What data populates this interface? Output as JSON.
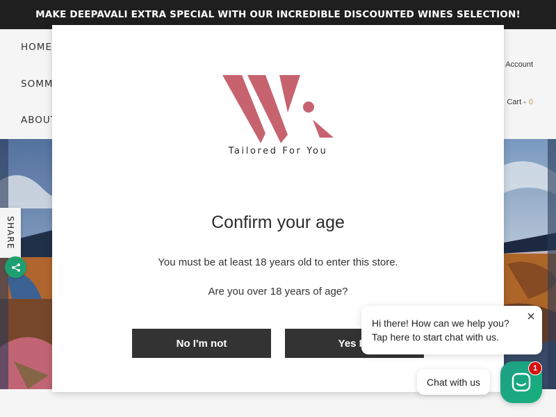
{
  "announcement": {
    "text": "MAKE DEEPAVALI EXTRA SPECIAL WITH OUR INCREDIBLE DISCOUNTED WINES SELECTION!"
  },
  "nav": {
    "items": [
      {
        "label": "HOME"
      },
      {
        "label": "SOMME"
      },
      {
        "label": "ABOUT"
      }
    ]
  },
  "header": {
    "account_label": "Account",
    "cart_label": "Cart -",
    "cart_count": "0",
    "icons": {
      "cart": "cart-icon"
    }
  },
  "share": {
    "label": "SHARE",
    "icon": "share-icon",
    "color": "#1ea676"
  },
  "age_gate": {
    "logo_tagline": "Tailored For You",
    "title": "Confirm your age",
    "message": "You must be at least 18 years old to enter this store.",
    "question": "Are you over 18 years of age?",
    "no_label": "No I'm not",
    "yes_label": "Yes I a",
    "logo_color": "#c7636f",
    "button_color": "#333333"
  },
  "chat": {
    "greeting_line1": "Hi there! How can we help you?",
    "greeting_line2": "Tap here to start chat with us.",
    "pill_label": "Chat with us",
    "badge_count": "1",
    "accent_color": "#1ea080",
    "badge_color": "#d80f0f"
  }
}
